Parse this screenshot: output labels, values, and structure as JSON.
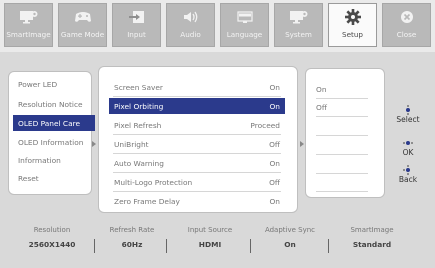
{
  "tabs": [
    {
      "id": "smartimage",
      "label": "SmartImage",
      "icon": "monitor-gear-icon"
    },
    {
      "id": "gamemode",
      "label": "Game Mode",
      "icon": "gamepad-icon"
    },
    {
      "id": "input",
      "label": "Input",
      "icon": "input-arrow-icon"
    },
    {
      "id": "audio",
      "label": "Audio",
      "icon": "speaker-icon"
    },
    {
      "id": "language",
      "label": "Language",
      "icon": "text-icon"
    },
    {
      "id": "system",
      "label": "System",
      "icon": "monitor-gear-icon"
    },
    {
      "id": "setup",
      "label": "Setup",
      "icon": "gear-icon",
      "active": true
    },
    {
      "id": "close",
      "label": "Close",
      "icon": "close-icon"
    }
  ],
  "menu_level1": [
    {
      "label": "Power LED"
    },
    {
      "label": "Resolution Notice"
    },
    {
      "label": "OLED Panel Care",
      "selected": true
    },
    {
      "label": "OLED Information"
    },
    {
      "label": "Information"
    },
    {
      "label": "Reset"
    }
  ],
  "menu_level2": [
    {
      "label": "Screen Saver",
      "value": "On"
    },
    {
      "label": "Pixel Orbiting",
      "value": "On",
      "selected": true
    },
    {
      "label": "Pixel Refresh",
      "value": "Proceed"
    },
    {
      "label": "UniBright",
      "value": "Off"
    },
    {
      "label": "Auto Warning",
      "value": "On"
    },
    {
      "label": "Multi-Logo Protection",
      "value": "Off"
    },
    {
      "label": "Zero Frame Delay",
      "value": "On"
    }
  ],
  "menu_level3": [
    {
      "label": "On"
    },
    {
      "label": "Off"
    }
  ],
  "controls": [
    {
      "label": "Select",
      "icon": "dpad-select-icon"
    },
    {
      "label": "OK",
      "icon": "dpad-ok-icon"
    },
    {
      "label": "Back",
      "icon": "dpad-back-icon"
    }
  ],
  "status": [
    {
      "key": "Resolution",
      "value": "2560X1440"
    },
    {
      "key": "Refresh Rate",
      "value": "60Hz"
    },
    {
      "key": "Input Source",
      "value": "HDMI"
    },
    {
      "key": "Adaptive Sync",
      "value": "On"
    },
    {
      "key": "SmartImage",
      "value": "Standard"
    }
  ],
  "colors": {
    "accent": "#2b3a8c",
    "tab_inactive": "#b9b9b9",
    "background": "#d9d9d9"
  }
}
